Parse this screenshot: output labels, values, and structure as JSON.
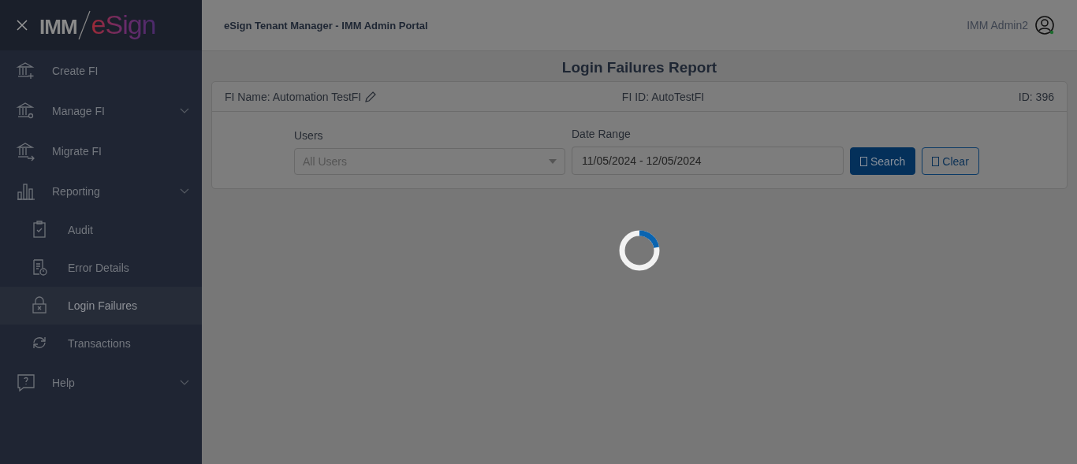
{
  "logo": {
    "prefix": "IMM",
    "brand": "eSign"
  },
  "sidebar": {
    "items": [
      {
        "label": "Create FI",
        "collapsible": false,
        "selected": false
      },
      {
        "label": "Manage FI",
        "collapsible": true,
        "selected": false
      },
      {
        "label": "Migrate FI",
        "collapsible": false,
        "selected": false
      },
      {
        "label": "Reporting",
        "collapsible": true,
        "selected": false,
        "children": [
          {
            "label": "Audit",
            "selected": false
          },
          {
            "label": "Error Details",
            "selected": false
          },
          {
            "label": "Login Failures",
            "selected": true
          },
          {
            "label": "Transactions",
            "selected": false
          }
        ]
      },
      {
        "label": "Help",
        "collapsible": true,
        "selected": false
      }
    ]
  },
  "header": {
    "title": "eSign Tenant Manager - IMM Admin Portal",
    "user": "IMM Admin2",
    "online": true
  },
  "page_title": "Login Failures Report",
  "info": {
    "fi_name": "FI Name: Automation TestFI",
    "fi_id": "FI ID: AutoTestFI",
    "id": "ID: 396"
  },
  "filters": {
    "users_label": "Users",
    "users_placeholder": "All Users",
    "date_label": "Date Range",
    "date_value": "11/05/2024 - 12/05/2024"
  },
  "buttons": [
    {
      "kind": "primary",
      "label": "Search"
    },
    {
      "kind": "outline",
      "label": "Clear"
    }
  ],
  "loading": {
    "level": 0.22
  }
}
